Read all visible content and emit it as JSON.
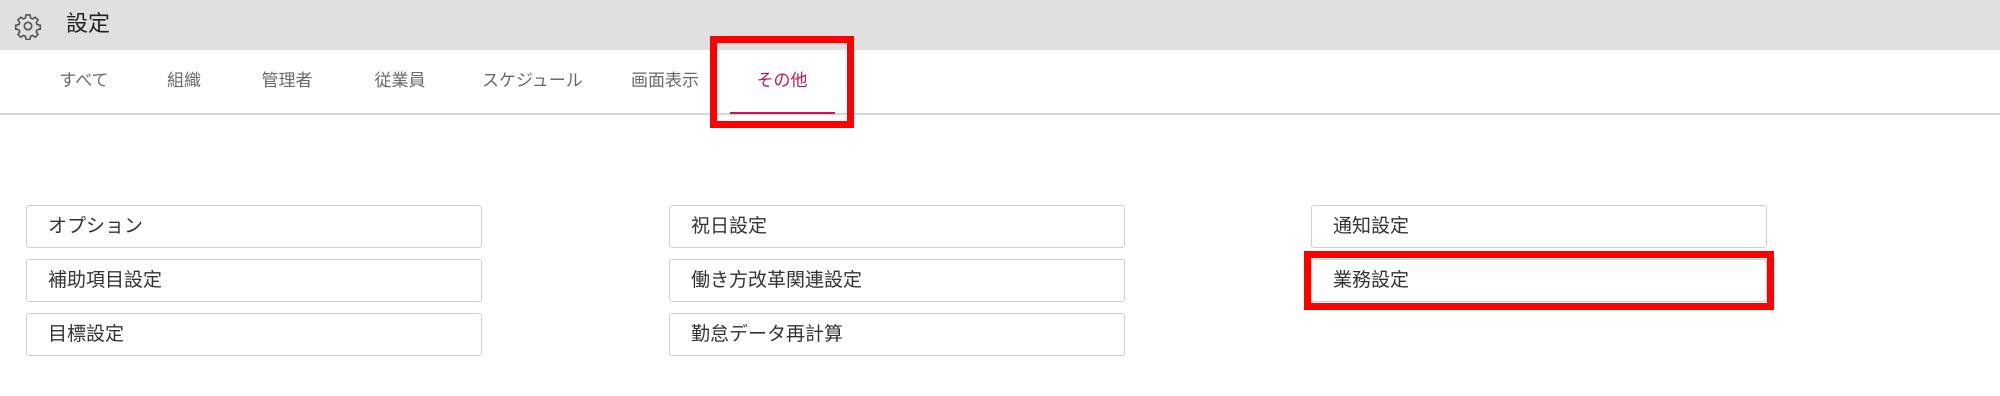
{
  "header": {
    "title": "設定",
    "icon": "gear-icon"
  },
  "tabs": [
    {
      "label": "すべて",
      "active": false
    },
    {
      "label": "組織",
      "active": false
    },
    {
      "label": "管理者",
      "active": false
    },
    {
      "label": "従業員",
      "active": false
    },
    {
      "label": "スケジュール",
      "active": false
    },
    {
      "label": "画面表示",
      "active": false
    },
    {
      "label": "その他",
      "active": true
    }
  ],
  "settings": {
    "col1": [
      "オプション",
      "補助項目設定",
      "目標設定"
    ],
    "col2": [
      "祝日設定",
      "働き方改革関連設定",
      "勤怠データ再計算"
    ],
    "col3": [
      "通知設定",
      "業務設定"
    ]
  },
  "colors": {
    "header_bg": "#e0e0e0",
    "active_tab": "#c2185b",
    "highlight": "#ff0000"
  }
}
